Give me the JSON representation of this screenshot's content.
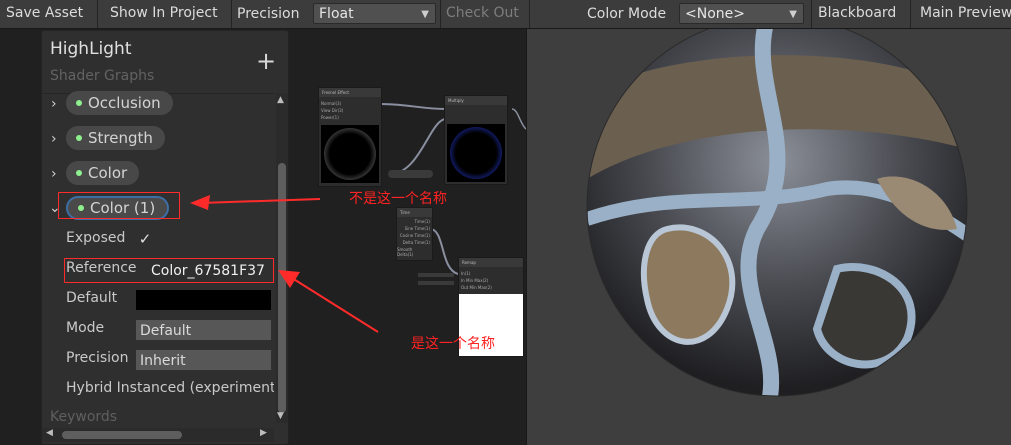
{
  "toolbar": {
    "save_asset": "Save Asset",
    "show_in_project": "Show In Project",
    "precision_label": "Precision",
    "precision_value": "Float",
    "check_out": "Check Out",
    "color_mode_label": "Color Mode",
    "color_mode_value": "<None>",
    "blackboard": "Blackboard",
    "main_preview": "Main Preview"
  },
  "blackboard": {
    "title": "HighLight",
    "subtitle": "Shader Graphs",
    "add_symbol": "+",
    "properties": [
      {
        "label": "Occlusion"
      },
      {
        "label": "Strength"
      },
      {
        "label": "Color"
      },
      {
        "label": "Color (1)"
      }
    ],
    "fields": {
      "exposed_label": "Exposed",
      "reference_label": "Reference",
      "reference_value": "Color_67581F37",
      "default_label": "Default",
      "mode_label": "Mode",
      "mode_value": "Default",
      "precision_label": "Precision",
      "precision_value": "Inherit",
      "hybrid_label": "Hybrid Instanced (experimental)"
    },
    "keywords_label": "Keywords"
  },
  "annotations": {
    "not_this_name": "不是这一个名称",
    "is_this_name": "是这一个名称",
    "color": "#ff2222"
  },
  "graph": {
    "fresnel_title": "Fresnel Effect",
    "multiply_title": "Multiply",
    "time_title": "Time",
    "remap_title": "Remap",
    "fresnel_ports": [
      "Normal(3)",
      "View Dir(3)",
      "Power(1)"
    ],
    "time_ports": [
      "Time(1)",
      "Sine Time(1)",
      "Cosine Time(1)",
      "Delta Time(1)",
      "Smooth Delta(1)"
    ],
    "remap_ports": [
      "In(1)",
      "In Min Max(2)",
      "Out Min Max(2)"
    ]
  },
  "colors": {
    "toolbar_bg": "#3c3c3c",
    "panel_bg": "#2f2f2f",
    "property_dot": "#8ef08e",
    "selection_outline": "#3d6ea6",
    "preview_bg": "#3e3e3e"
  }
}
